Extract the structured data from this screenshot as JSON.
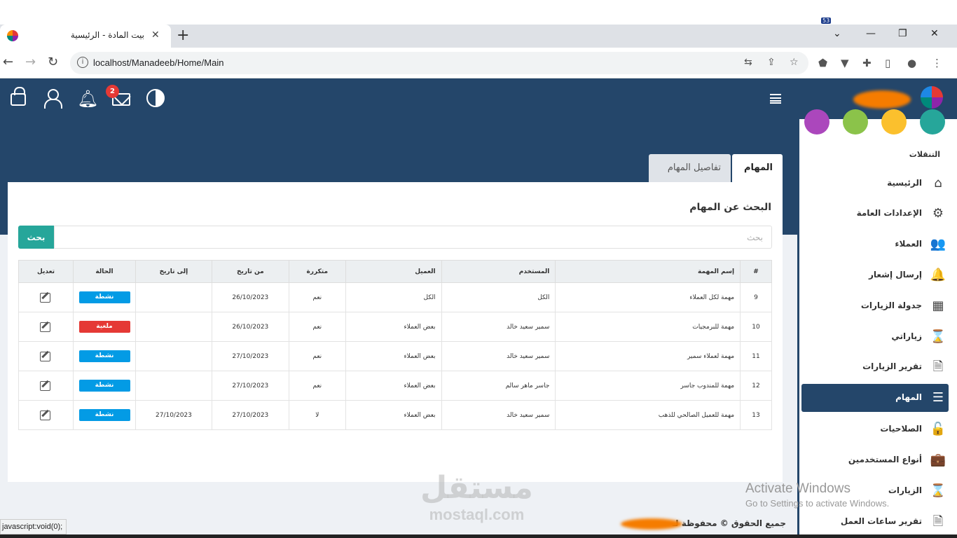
{
  "browser": {
    "tab_title": "بيت المادة - الرئيسية",
    "url": "localhost/Manadeeb/Home/Main",
    "extension_badge": "53",
    "status_url": "javascript:void(0);"
  },
  "header": {
    "mail_badge": "2"
  },
  "tabs": [
    {
      "label": "المهام",
      "active": true
    },
    {
      "label": "تفاصيل المهام",
      "active": false
    }
  ],
  "search": {
    "title": "البحث عن المهام",
    "placeholder": "بحث",
    "button_label": "بحث"
  },
  "table": {
    "columns": [
      "#",
      "إسم المهمة",
      "المستخدم",
      "العميل",
      "متكررة",
      "من تاريخ",
      "إلى تاريخ",
      "الحالة",
      "تعديل"
    ],
    "rows": [
      {
        "num": "9",
        "name": "مهمة لكل العملاء",
        "user": "الكل",
        "client": "الكل",
        "recurring": "نعم",
        "from": "26/10/2023",
        "to": "",
        "status": "نشطة",
        "status_color": "#039be5"
      },
      {
        "num": "10",
        "name": "مهمة للبرمجيات",
        "user": "سمير سعيد خالد",
        "client": "بعض العملاء",
        "recurring": "نعم",
        "from": "26/10/2023",
        "to": "",
        "status": "ملغية",
        "status_color": "#e53935"
      },
      {
        "num": "11",
        "name": "مهمة لعملاء سمير",
        "user": "سمير سعيد خالد",
        "client": "بعض العملاء",
        "recurring": "نعم",
        "from": "27/10/2023",
        "to": "",
        "status": "نشطة",
        "status_color": "#039be5"
      },
      {
        "num": "12",
        "name": "مهمة للمندوب جاسر",
        "user": "جاسر ماهر سالم",
        "client": "بعض العملاء",
        "recurring": "نعم",
        "from": "27/10/2023",
        "to": "",
        "status": "نشطة",
        "status_color": "#039be5"
      },
      {
        "num": "13",
        "name": "مهمة للعميل الصالحي للذهب",
        "user": "سمير سعيد خالد",
        "client": "بعض العملاء",
        "recurring": "لا",
        "from": "27/10/2023",
        "to": "27/10/2023",
        "status": "نشطة",
        "status_color": "#039be5"
      }
    ]
  },
  "sidebar": {
    "heading": "التنقلات",
    "items": [
      {
        "label": "الرئيسية",
        "icon": "home-icon",
        "glyph": "⌂"
      },
      {
        "label": "الإعدادات العامة",
        "icon": "gears-icon",
        "glyph": "⚙"
      },
      {
        "label": "العملاء",
        "icon": "users-icon",
        "glyph": "👥"
      },
      {
        "label": "إرسال إشعار",
        "icon": "bell-icon",
        "glyph": "🔔"
      },
      {
        "label": "جدولة الزيارات",
        "icon": "calendar-icon",
        "glyph": "▦"
      },
      {
        "label": "زياراتي",
        "icon": "hourglass-icon",
        "glyph": "⌛"
      },
      {
        "label": "تقرير الزيارات",
        "icon": "document-icon",
        "glyph": "🗎"
      },
      {
        "label": "المهام",
        "icon": "list-icon",
        "glyph": "☰"
      },
      {
        "label": "الصلاحيات",
        "icon": "unlock-icon",
        "glyph": "🔓"
      },
      {
        "label": "أنواع المستخدمين",
        "icon": "briefcase-icon",
        "glyph": "💼"
      },
      {
        "label": "الزيارات",
        "icon": "hourglass-icon",
        "glyph": "⌛"
      },
      {
        "label": "تقرير ساعات العمل",
        "icon": "document-icon",
        "glyph": "🗎"
      }
    ],
    "active_index": 7
  },
  "footer": {
    "copyright": "جميع الحقوق © محفوظة لـ"
  },
  "os_overlay": {
    "activate_title": "Activate Windows",
    "activate_sub": "Go to Settings to activate Windows."
  },
  "watermark": {
    "arabic": "مستقل",
    "latin": "mostaql.com"
  },
  "colors": {
    "primary": "#24466a",
    "search_button": "#26a69a",
    "active_status": "#039be5",
    "cancelled_status": "#e53935"
  }
}
